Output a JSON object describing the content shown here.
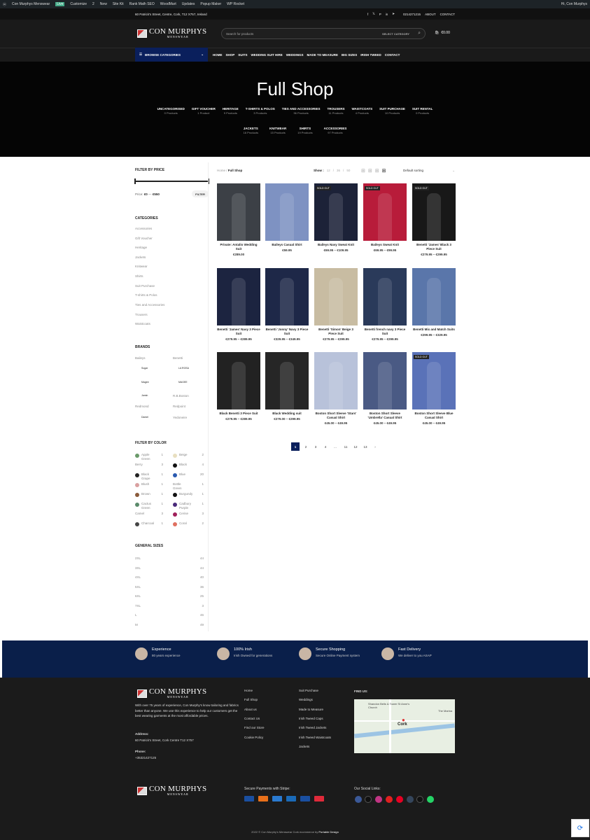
{
  "admin_bar": {
    "items": [
      "Con Murphys Menswear",
      "Customize",
      "2",
      "New",
      "Site Kit",
      "Rank Math SEO",
      "WoodMart",
      "Updates",
      "Popup Maker",
      "WP Rocket"
    ],
    "live": "Live",
    "greeting": "Hi, Con Murphys"
  },
  "top_bar": {
    "address": "60 Patrick's Street, Centre, Cork, T12 X757, Ireland",
    "phone": "0214271215",
    "about": "ABOUT",
    "contact": "CONTACT"
  },
  "logo": {
    "name": "CON MURPHYS",
    "sub": "MENSWEAR"
  },
  "search": {
    "placeholder": "Search for products",
    "category": "SELECT CATEGORY"
  },
  "cart": {
    "total": "€0.00"
  },
  "browse": "BROWSE CATEGORIES",
  "menu": [
    "HOME",
    "SHOP",
    "SUITS",
    "WEDDING SUIT HIRE",
    "WEDDINGS",
    "MADE TO MEASURE",
    "BIG SIZES",
    "IRISH TWEED",
    "CONTACT"
  ],
  "hero": {
    "title": "Full Shop",
    "row1": [
      {
        "n": "UNCATEGORISED",
        "c": "0 Products"
      },
      {
        "n": "GIFT VOUCHER",
        "c": "1 Product"
      },
      {
        "n": "HERITAGE",
        "c": "9 Products"
      },
      {
        "n": "T-SHIRTS & POLOS",
        "c": "3 Products"
      },
      {
        "n": "TIES AND ACCESSORIES",
        "c": "96 Products"
      },
      {
        "n": "TROUSERS",
        "c": "11 Products"
      },
      {
        "n": "WAISTCOATS",
        "c": "4 Products"
      },
      {
        "n": "SUIT PURCHASE",
        "c": "10 Products"
      },
      {
        "n": "SUIT RENTAL",
        "c": "0 Products"
      }
    ],
    "row2": [
      {
        "n": "JACKETS",
        "c": "16 Products"
      },
      {
        "n": "KNITWEAR",
        "c": "15 Products"
      },
      {
        "n": "SHIRTS",
        "c": "19 Products"
      },
      {
        "n": "ACCESSORIES",
        "c": "97 Products"
      }
    ]
  },
  "sidebar": {
    "price": {
      "title": "FILTER BY PRICE",
      "label": "Price:",
      "min": "€0",
      "max": "€550",
      "button": "FILTER"
    },
    "categories": {
      "title": "CATEGORIES",
      "items": [
        "Accessories",
        "Gift Voucher",
        "Heritage",
        "Jackets",
        "Knitwear",
        "Shirts",
        "Suit Purchase",
        "T-shirts & Polos",
        "Ties and Accessories",
        "Trousers",
        "Waistcoats"
      ]
    },
    "brands": {
      "title": "BRANDS",
      "items": [
        "Baileys",
        "Benetti",
        "Sugar",
        "LA ROSA",
        "Magee",
        "MAGEE",
        "Jamin",
        "R.B.Boston",
        "Redmond",
        "Redpoint",
        "Daniel",
        "Yedoneire"
      ]
    },
    "colors": {
      "title": "FILTER BY COLOR",
      "items": [
        {
          "n": "Apple Green",
          "c": "1",
          "col": "#6a9a6a"
        },
        {
          "n": "Beige",
          "c": "2",
          "col": "#e8dfc0"
        },
        {
          "n": "Berry",
          "c": "3",
          "col": ""
        },
        {
          "n": "Black",
          "c": "4",
          "col": "#111"
        },
        {
          "n": "Black Grape",
          "c": "1",
          "col": "#222"
        },
        {
          "n": "Blue",
          "c": "20",
          "col": "#2a5ab0"
        },
        {
          "n": "Blush",
          "c": "1",
          "col": "#d9a0a0"
        },
        {
          "n": "Bottle Green",
          "c": "1",
          "col": ""
        },
        {
          "n": "Brown",
          "c": "1",
          "col": "#8a5a3a"
        },
        {
          "n": "Burgundy",
          "c": "1",
          "col": "#111"
        },
        {
          "n": "Cactus Green",
          "c": "1",
          "col": "#5a8a6a"
        },
        {
          "n": "Cadbury Purple",
          "c": "1",
          "col": "#4a2a7a"
        },
        {
          "n": "Camel",
          "c": "3",
          "col": ""
        },
        {
          "n": "Cerise",
          "c": "3",
          "col": "#a0205a"
        },
        {
          "n": "Charcoal",
          "c": "1",
          "col": "#444"
        },
        {
          "n": "Coral",
          "c": "2",
          "col": "#e07060"
        }
      ]
    },
    "sizes": {
      "title": "GENERAL SIZES",
      "items": [
        {
          "n": "2XL",
          "c": "44"
        },
        {
          "n": "3XL",
          "c": "44"
        },
        {
          "n": "4XL",
          "c": "40"
        },
        {
          "n": "5XL",
          "c": "36"
        },
        {
          "n": "6XL",
          "c": "25"
        },
        {
          "n": "7XL",
          "c": "3"
        },
        {
          "n": "L",
          "c": "46"
        },
        {
          "n": "M",
          "c": "49"
        }
      ]
    }
  },
  "toolbar": {
    "home": "Home",
    "current": "Full Shop",
    "show_label": "Show :",
    "show": [
      "12",
      "36",
      "50"
    ],
    "sort": "Default sorting"
  },
  "products": [
    {
      "n": "Private: Antalio Wedding Suit",
      "p": "€289.00",
      "s": false,
      "bg": "#3c4046"
    },
    {
      "n": "Baileys Casual Shirt",
      "p": "€59.95",
      "s": false,
      "bg": "#7e92c2"
    },
    {
      "n": "Baileys Navy Sweat Knit",
      "p": "€69.95 – €109.95",
      "s": true,
      "bg": "#1c2238"
    },
    {
      "n": "Baileys Sweat Knit",
      "p": "€69.95 – €99.95",
      "s": true,
      "bg": "#b81c3a"
    },
    {
      "n": "Benetti 'James' Black 3 Piece Suit",
      "p": "€279.95 – €299.95",
      "s": true,
      "bg": "#181818"
    },
    {
      "n": "Benetti 'James' Navy 3 Piece Suit",
      "p": "€279.95 – €289.95",
      "s": false,
      "bg": "#1c2440"
    },
    {
      "n": "Benetti 'Jonny' Navy 3 Piece Suit",
      "p": "€329.95 – €349.95",
      "s": false,
      "bg": "#1e2848"
    },
    {
      "n": "Benetti 'Simon' Beige 3 Piece Suit",
      "p": "€279.95 – €299.95",
      "s": false,
      "bg": "#c8bca2"
    },
    {
      "n": "Benetti french navy 3 Piece Suit",
      "p": "€279.95 – €299.95",
      "s": false,
      "bg": "#2a3a5a"
    },
    {
      "n": "Benetti Mix and Match Suits",
      "p": "€299.95 – €329.95",
      "s": false,
      "bg": "#5a76aa"
    },
    {
      "n": "Black Benetti 3 Piece Suit",
      "p": "€279.95 – €289.95",
      "s": false,
      "bg": "#222"
    },
    {
      "n": "Black Wedding suit",
      "p": "€279.00 – €299.95",
      "s": false,
      "bg": "#262626"
    },
    {
      "n": "Boston Short Sleeve 'Stars' Casual Shirt",
      "p": "€45.00 – €49.95",
      "s": false,
      "bg": "#b8c2da"
    },
    {
      "n": "Boston Short Sleeve 'Umbrella' Casual Shirt",
      "p": "€45.00 – €49.95",
      "s": false,
      "bg": "#4a5a84"
    },
    {
      "n": "Boston Short Sleeve Blue Casual Shirt",
      "p": "€45.00 – €49.95",
      "s": true,
      "bg": "#5a72b8"
    }
  ],
  "sold_label": "SOLD OUT",
  "pagination": [
    "1",
    "2",
    "3",
    "4",
    "...",
    "11",
    "12",
    "13",
    "›"
  ],
  "features": [
    {
      "t": "Experience",
      "d": "80 years experience"
    },
    {
      "t": "100% Irish",
      "d": "Irish Owned for generations"
    },
    {
      "t": "Secure Shopping",
      "d": "Secure Online Payment system"
    },
    {
      "t": "Fast Delivery",
      "d": "We deliver to you ASAP"
    }
  ],
  "footer": {
    "about": "With over 75 years of experience, Con Murphy's know tailoring and fabrics better than anyone. We use this experience to help our customers get the best wearing garments at the most affordable prices.",
    "address_label": "Address:",
    "address": "60 Patrick's Street, Cork Centre T12 X757",
    "phone_label": "Phone:",
    "phone": "+35321427125",
    "col1": [
      "Home",
      "Full Shop",
      "About us",
      "Contact Us",
      "Find our Store",
      "Cookie Policy"
    ],
    "col2": [
      "Suit Purchase",
      "Weddings",
      "Made to Measure",
      "Irish Tweed Caps",
      "Irish Tweed Jackets",
      "Irish Tweed Waistcoats",
      "Jackets"
    ],
    "find_us": "FIND US:",
    "map_labels": [
      "Shandon Bells & Tower St Anne's Church",
      "Cork",
      "The Marina"
    ],
    "secure": "Secure Payments with Stripe:",
    "social": "Our Social Links:",
    "copyright": "2022 © Con Murphy's Menswear Cork",
    "credit_mid": " ecommerce by ",
    "credit": "Portable Design"
  },
  "colors": {
    "navy": "#0a1f5c",
    "feature_bg": "#0a1f4a",
    "footer_bg": "#1b1b1b"
  }
}
